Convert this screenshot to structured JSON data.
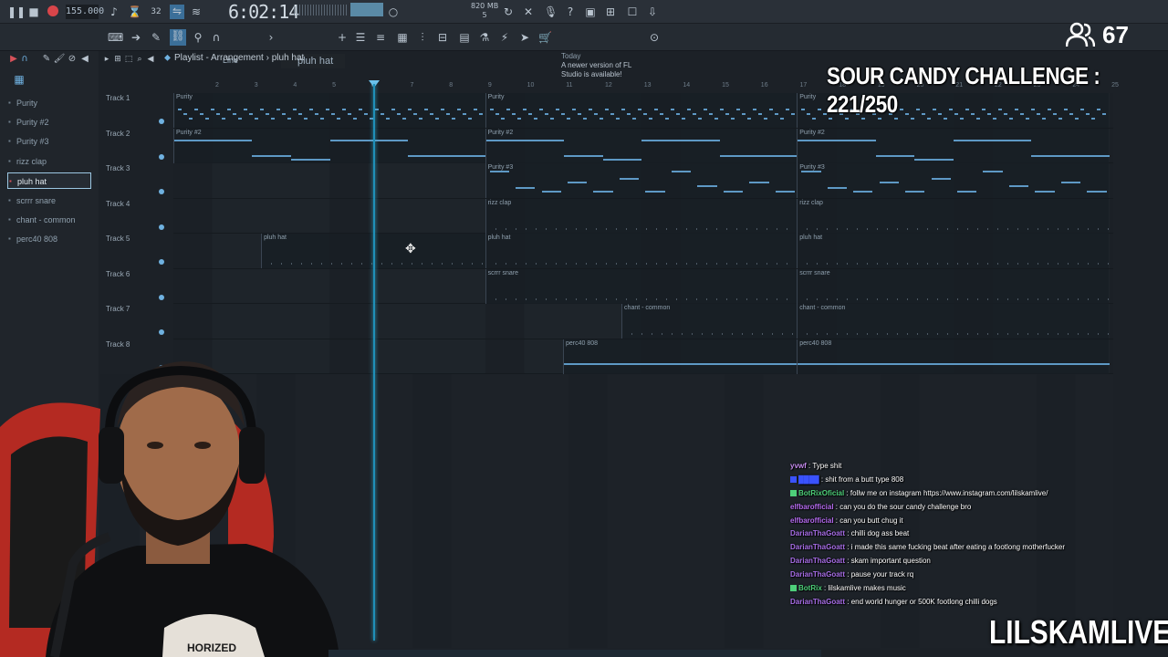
{
  "toolbar": {
    "tempo": "155.000",
    "time": "6:02:14",
    "time_suffix": "B:S:T",
    "cpu": "4",
    "memory": "820 MB",
    "voices": "5",
    "pattern": "pluh hat",
    "snap_mode": "Line",
    "news_date": "Today",
    "news_text": "A newer version of FL Studio is available!"
  },
  "playlist": {
    "title": "Playlist - Arrangement",
    "breadcrumb": "pluh hat",
    "ruler": [
      "2",
      "3",
      "4",
      "5",
      "6",
      "7",
      "8",
      "9",
      "10",
      "11",
      "12",
      "13",
      "14",
      "15",
      "16",
      "17",
      "18",
      "19",
      "20",
      "21",
      "22",
      "23",
      "24",
      "25"
    ],
    "tracks": [
      {
        "name": "Track 1"
      },
      {
        "name": "Track 2"
      },
      {
        "name": "Track 3"
      },
      {
        "name": "Track 4"
      },
      {
        "name": "Track 5"
      },
      {
        "name": "Track 6"
      },
      {
        "name": "Track 7"
      },
      {
        "name": "Track 8"
      }
    ],
    "clip_names": {
      "purity": "Purity",
      "purity2": "Purity #2",
      "purity3": "Purity #3",
      "rizz": "rizz clap",
      "pluh": "pluh hat",
      "scrrr": "scrrr snare",
      "chant": "chant - common",
      "perc": "perc40 808"
    }
  },
  "browser": {
    "items": [
      {
        "label": "Purity"
      },
      {
        "label": "Purity #2"
      },
      {
        "label": "Purity #3"
      },
      {
        "label": "rizz clap"
      },
      {
        "label": "pluh hat"
      },
      {
        "label": "scrrr snare"
      },
      {
        "label": "chant - common"
      },
      {
        "label": "perc40 808"
      }
    ],
    "selected_index": 4
  },
  "overlay": {
    "viewer_count": "67",
    "challenge": "SOUR CANDY CHALLENGE : 221/250",
    "brand": "LILSKAMLIVE"
  },
  "chat": [
    {
      "user": "yvwf",
      "user_color": "#c68cf0",
      "msg": "Type shit"
    },
    {
      "user": "████",
      "user_color": "#3a52ff",
      "msg": "shit from a butt type 808"
    },
    {
      "user": "BotRixOficial",
      "user_color": "#4ed07a",
      "msg": "follw me on instagram https://www.instagram.com/lilskamlive/"
    },
    {
      "user": "elfbarofficial",
      "user_color": "#b56bf0",
      "msg": "can you do the sour candy challenge bro"
    },
    {
      "user": "elfbarofficial",
      "user_color": "#b56bf0",
      "msg": "can you butt chug it"
    },
    {
      "user": "DarianThaGoatt",
      "user_color": "#a86ee8",
      "msg": "chilli dog ass beat"
    },
    {
      "user": "DarianThaGoatt",
      "user_color": "#a86ee8",
      "msg": "i made this same fucking beat after eating a footlong motherfucker"
    },
    {
      "user": "DarianThaGoatt",
      "user_color": "#a86ee8",
      "msg": "skam important question"
    },
    {
      "user": "DarianThaGoatt",
      "user_color": "#a86ee8",
      "msg": "pause your track rq"
    },
    {
      "user": "BotRix",
      "user_color": "#4ed07a",
      "msg": "lilskamlive makes music"
    },
    {
      "user": "DarianThaGoatt",
      "user_color": "#a86ee8",
      "msg": "end world hunger or 500K footlong chilli dogs"
    }
  ],
  "webcam": {
    "shirt_text": "HORIZED"
  },
  "colors": {
    "note": "#5e99c5",
    "playhead": "#1f8fb8",
    "accent": "#6fb1e0"
  }
}
